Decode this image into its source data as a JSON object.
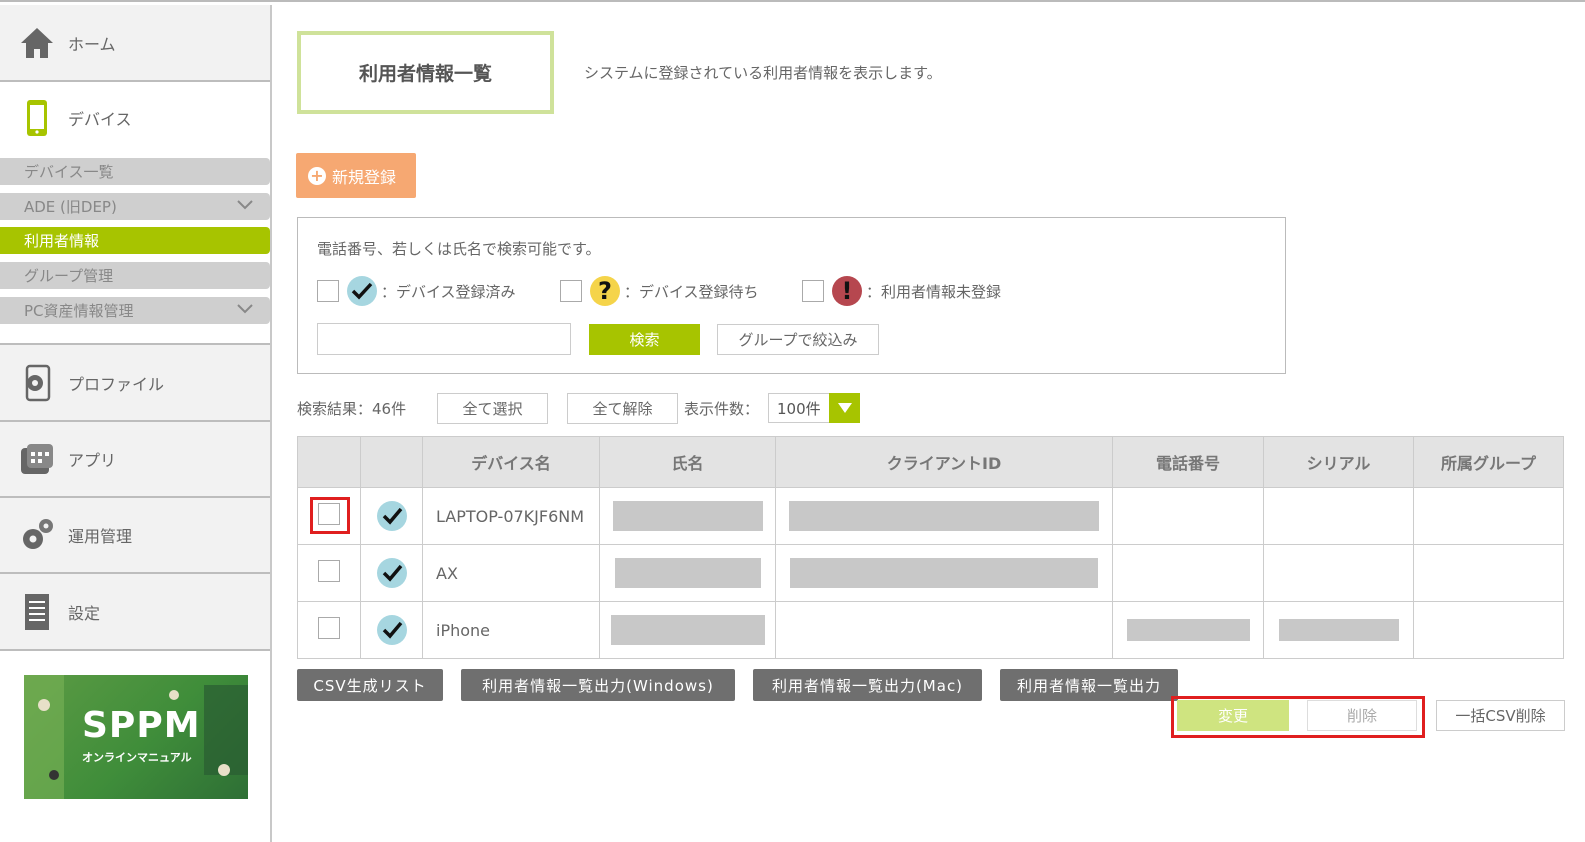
{
  "sidebar": {
    "home": "ホーム",
    "device": "デバイス",
    "device_sub": [
      {
        "label": "デバイス一覧"
      },
      {
        "label": "ADE (旧DEP)"
      },
      {
        "label": "利用者情報"
      },
      {
        "label": "グループ管理"
      },
      {
        "label": "PC資産情報管理"
      }
    ],
    "profile": "プロファイル",
    "app": "アプリ",
    "operations": "運用管理",
    "settings": "設定",
    "banner": {
      "title": "SPPM",
      "subtitle": "オンラインマニュアル"
    }
  },
  "page": {
    "title": "利用者情報一覧",
    "description": "システムに登録されている利用者情報を表示します。"
  },
  "new_button": "新規登録",
  "search": {
    "hint": "電話番号、若しくは氏名で検索可能です。",
    "legend": [
      {
        "label": "：デバイス登録済み",
        "icon": "check-icon"
      },
      {
        "label": "：デバイス登録待ち",
        "icon": "question-icon"
      },
      {
        "label": "：利用者情報未登録",
        "icon": "exclamation-icon"
      }
    ],
    "input_value": "",
    "search_button": "検索",
    "group_button": "グループで絞込み"
  },
  "results": {
    "count_label": "検索結果：46件",
    "select_all": "全て選択",
    "deselect_all": "全て解除",
    "per_page_label": "表示件数：",
    "per_page_value": "100件"
  },
  "table": {
    "headers": [
      "",
      "",
      "デバイス名",
      "氏名",
      "クライアントID",
      "電話番号",
      "シリアル",
      "所属グループ"
    ],
    "rows": [
      {
        "device_name": "LAPTOP-07KJF6NM"
      },
      {
        "device_name": "AX"
      },
      {
        "device_name": "iPhone"
      }
    ]
  },
  "actions": {
    "csv_list": "CSV生成リスト",
    "export_windows": "利用者情報一覧出力(Windows)",
    "export_mac": "利用者情報一覧出力(Mac)",
    "export": "利用者情報一覧出力",
    "change": "変更",
    "delete": "削除",
    "bulk_csv_delete": "一括CSV削除"
  },
  "colors": {
    "accent": "#a7c400",
    "orange": "#f6a872",
    "highlight": "#e01f1f"
  }
}
